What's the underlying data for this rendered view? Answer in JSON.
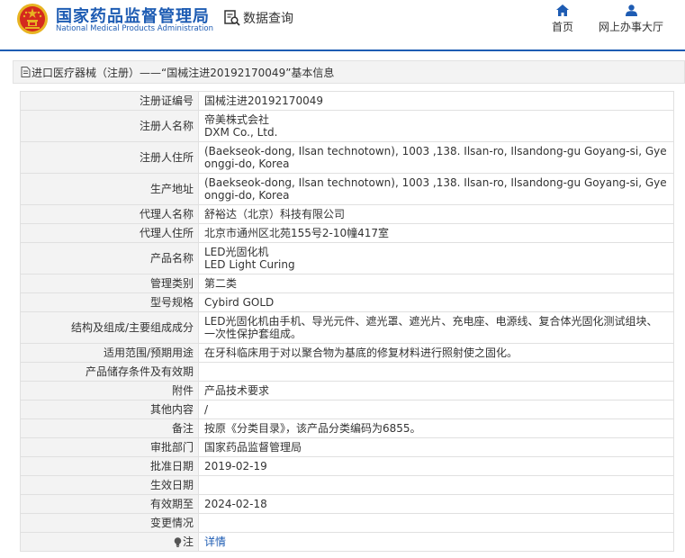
{
  "header": {
    "org_name_cn": "国家药品监督管理局",
    "org_name_en": "National Medical Products Administration",
    "query_label": "数据查询",
    "nav": {
      "home_label": "首页",
      "service_label": "网上办事大厅"
    }
  },
  "breadcrumb": {
    "text": "进口医疗器械（注册）——“国械注进20192170049”基本信息"
  },
  "rows": [
    {
      "label": "注册证编号",
      "value": "国械注进20192170049"
    },
    {
      "label": "注册人名称",
      "lines": [
        "帝美株式会社",
        "DXM Co., Ltd."
      ]
    },
    {
      "label": "注册人住所",
      "value": "(Baekseok-dong, Ilsan technotown), 1003 ,138. Ilsan-ro, Ilsandong-gu Goyang-si, Gyeonggi-do, Korea"
    },
    {
      "label": "生产地址",
      "value": "(Baekseok-dong, Ilsan technotown), 1003 ,138. Ilsan-ro, Ilsandong-gu Goyang-si, Gyeonggi-do, Korea"
    },
    {
      "label": "代理人名称",
      "value": "舒裕达（北京）科技有限公司"
    },
    {
      "label": "代理人住所",
      "value": "北京市通州区北苑155号2-10幢417室"
    },
    {
      "label": "产品名称",
      "lines": [
        "LED光固化机",
        "LED Light Curing"
      ]
    },
    {
      "label": "管理类别",
      "value": "第二类"
    },
    {
      "label": "型号规格",
      "value": "Cybird GOLD"
    },
    {
      "label": "结构及组成/主要组成成分",
      "value": "LED光固化机由手机、导光元件、遮光罩、遮光片、充电座、电源线、复合体光固化测试组块、一次性保护套组成。"
    },
    {
      "label": "适用范围/预期用途",
      "value": "在牙科临床用于对以聚合物为基底的修复材料进行照射使之固化。"
    },
    {
      "label": "产品储存条件及有效期",
      "value": ""
    },
    {
      "label": "附件",
      "value": "产品技术要求"
    },
    {
      "label": "其他内容",
      "value": "/"
    },
    {
      "label": "备注",
      "value": "按原《分类目录》，该产品分类编码为6855。"
    },
    {
      "label": "审批部门",
      "value": "国家药品监督管理局"
    },
    {
      "label": "批准日期",
      "value": "2019-02-19"
    },
    {
      "label": "生效日期",
      "value": ""
    },
    {
      "label": "有效期至",
      "value": "2024-02-18"
    },
    {
      "label": "变更情况",
      "value": ""
    },
    {
      "label": "注",
      "value": "详情"
    }
  ],
  "colors": {
    "brand_blue": "#1e5cb3",
    "label_bg": "#f3f3f3",
    "border": "#e0e0e0",
    "emblem_red": "#d42a1e",
    "emblem_gold": "#e8b422"
  }
}
